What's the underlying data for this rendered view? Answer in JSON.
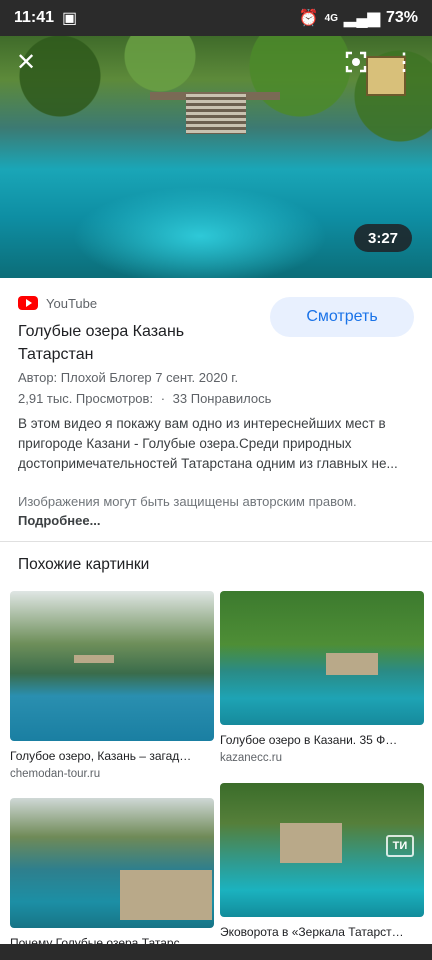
{
  "status": {
    "time": "11:41",
    "battery": "73%",
    "network": "4G"
  },
  "hero": {
    "duration": "3:27"
  },
  "video": {
    "source": "YouTube",
    "title": "Голубые озера Казань Татарстан",
    "watch_label": "Смотреть",
    "author": "Автор: Плохой Блогер 7 сент. 2020 г.",
    "views": "2,91 тыс. Просмотров:",
    "dot": "·",
    "likes": "33 Понравилось",
    "description": "В этом видео я покажу вам одно из интереснейших мест в пригороде Казани - Голубые озера.Среди природных достопримечательностей Татарстана одним из главных не...",
    "copyright": "Изображения могут быть защищены авторским правом.",
    "more_link": "Подробнее..."
  },
  "related": {
    "title": "Похожие картинки",
    "items": [
      {
        "caption": "Голубое озеро, Казань – загад…",
        "domain": "chemodan-tour.ru"
      },
      {
        "caption": "Голубое озеро в Казани. 35 Ф…",
        "domain": "kazanecc.ru"
      },
      {
        "caption": "Почему Голубые озера Татарс…",
        "domain": ""
      },
      {
        "caption": "Эковорота в «Зеркала Татарст…",
        "domain": "",
        "badge": "ТИ"
      }
    ]
  }
}
